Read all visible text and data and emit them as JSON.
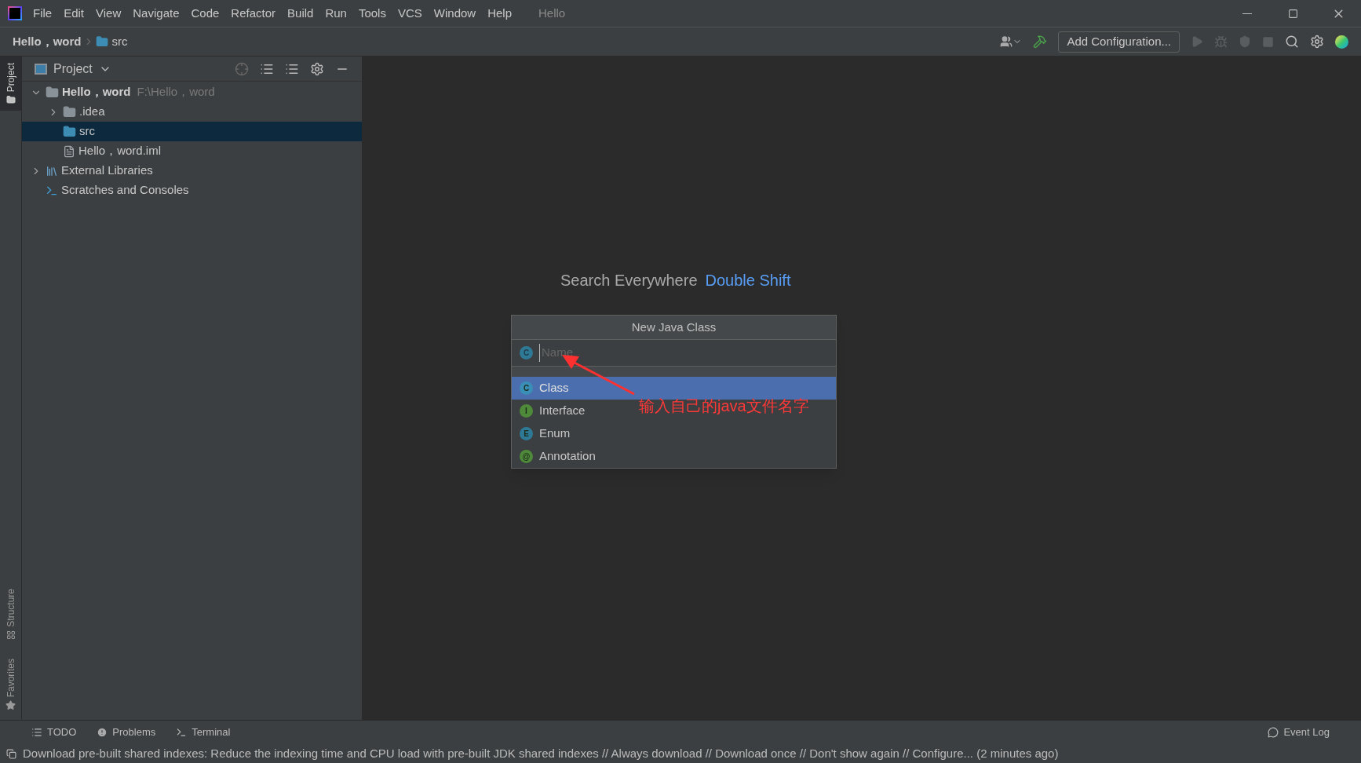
{
  "menu_bar": {
    "items": [
      "File",
      "Edit",
      "View",
      "Navigate",
      "Code",
      "Refactor",
      "Build",
      "Run",
      "Tools",
      "VCS",
      "Window",
      "Help"
    ],
    "project_title": "Hello"
  },
  "breadcrumb": {
    "project": "Hello，word",
    "folder": "src"
  },
  "toolbar": {
    "configuration": "Add Configuration..."
  },
  "side_tabs_top": [
    {
      "label": "Project",
      "selected": true
    }
  ],
  "side_tabs_bottom": [
    {
      "label": "Structure",
      "selected": false
    },
    {
      "label": "Favorites",
      "selected": false
    }
  ],
  "project_panel": {
    "title": "Project",
    "tree": [
      {
        "label": "Hello，word",
        "path": "F:\\Hello，word",
        "kind": "module",
        "expanded": true,
        "selected": false,
        "children": [
          {
            "label": ".idea",
            "kind": "folder",
            "expanded": false,
            "selected": false
          },
          {
            "label": "src",
            "kind": "source",
            "selected": true
          },
          {
            "label": "Hello，word.iml",
            "kind": "file",
            "selected": false
          }
        ]
      },
      {
        "label": "External Libraries",
        "kind": "libraries",
        "expanded": false,
        "selected": false
      },
      {
        "label": "Scratches and Consoles",
        "kind": "scratches",
        "selected": false
      }
    ]
  },
  "editor_hints": [
    {
      "action": "Search Everywhere",
      "shortcut": "Double Shift"
    }
  ],
  "dialog": {
    "title": "New Java Class",
    "name_icon": "C",
    "placeholder": "Name",
    "options": [
      {
        "label": "Class",
        "icon": "C",
        "kind": "class",
        "selected": true
      },
      {
        "label": "Interface",
        "icon": "I",
        "kind": "interface",
        "selected": false
      },
      {
        "label": "Enum",
        "icon": "E",
        "kind": "enum",
        "selected": false
      },
      {
        "label": "Annotation",
        "icon": "@",
        "kind": "annotation",
        "selected": false
      }
    ]
  },
  "annotation": "输入自己的java文件名字",
  "tool_window_bar": {
    "left": [
      "TODO",
      "Problems",
      "Terminal"
    ],
    "right": "Event Log"
  },
  "status_bar": "Download pre-built shared indexes: Reduce the indexing time and CPU load with pre-built JDK shared indexes // Always download // Download once // Don't show again // Configure... (2 minutes ago)"
}
